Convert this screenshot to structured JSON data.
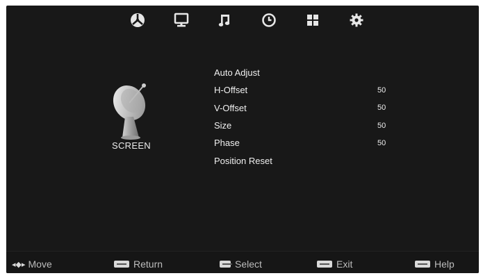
{
  "top_nav": {
    "icons": [
      {
        "name": "channel-icon"
      },
      {
        "name": "picture-icon"
      },
      {
        "name": "sound-icon"
      },
      {
        "name": "time-icon"
      },
      {
        "name": "lock-icon"
      },
      {
        "name": "setup-icon"
      }
    ]
  },
  "device": {
    "label": "SCREEN",
    "icon": "satellite-dish-icon"
  },
  "menu": {
    "items": [
      {
        "label": "Auto Adjust",
        "value": ""
      },
      {
        "label": "H-Offset",
        "value": "50"
      },
      {
        "label": "V-Offset",
        "value": "50"
      },
      {
        "label": "Size",
        "value": "50"
      },
      {
        "label": "Phase",
        "value": "50"
      },
      {
        "label": "Position Reset",
        "value": ""
      }
    ]
  },
  "hints": {
    "move": "Move",
    "return": "Return",
    "select": "Select",
    "exit": "Exit",
    "help": "Help"
  },
  "colors": {
    "background": "#181818",
    "text": "#e8e8e8"
  }
}
